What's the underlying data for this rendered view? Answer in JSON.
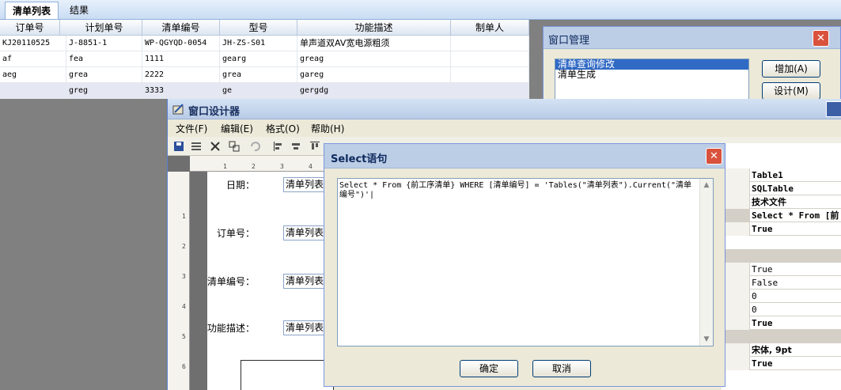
{
  "tabs": [
    "清单列表",
    "结果"
  ],
  "grid": {
    "headers": [
      "订单号",
      "计划单号",
      "清单编号",
      "型号",
      "功能描述",
      "制单人"
    ],
    "rows": [
      [
        "KJ20110525",
        "J-8851-1",
        "WP-QGYQD-0054",
        "JH-ZS-S01",
        "单声道双AV宽电源粗须",
        ""
      ],
      [
        "af",
        "fea",
        "1111",
        "gearg",
        "greag",
        ""
      ],
      [
        "aeg",
        "grea",
        "2222",
        "grea",
        "gareg",
        ""
      ],
      [
        "",
        "greg",
        "3333",
        "ge",
        "gergdg",
        ""
      ]
    ]
  },
  "window_manager": {
    "title": "窗口管理",
    "items": [
      "清单查询修改",
      "清单生成"
    ],
    "buttons": [
      "增加(A)",
      "设计(M)"
    ],
    "close": "✕"
  },
  "designer": {
    "title": "窗口设计器",
    "menu": [
      "文件(F)",
      "编辑(E)",
      "格式(O)",
      "帮助(H)"
    ],
    "ruler_top": [
      "1",
      "2",
      "3",
      "4"
    ],
    "ruler_left": [
      "1",
      "2",
      "3",
      "4",
      "5",
      "6"
    ],
    "form_fields": [
      {
        "label": "日期：",
        "value": "清单列表"
      },
      {
        "label": "订单号：",
        "value": "清单列表"
      },
      {
        "label": "清单编号：",
        "value": "清单列表"
      },
      {
        "label": "功能描述：",
        "value": "清单列表"
      }
    ],
    "props": [
      "Table1",
      "SQLTable",
      "技术文件",
      "Select * From [前",
      "True",
      "",
      "True",
      "False",
      "0",
      "0",
      "True",
      "",
      "宋体, 9pt",
      "True"
    ]
  },
  "select_dialog": {
    "title": "Select语句",
    "sql": "Select * From {前工序清单} WHERE [清单编号] = 'Tables(\"清单列表\").Current(\"清单编号\")'|",
    "ok": "确定",
    "cancel": "取消",
    "close": "✕"
  }
}
